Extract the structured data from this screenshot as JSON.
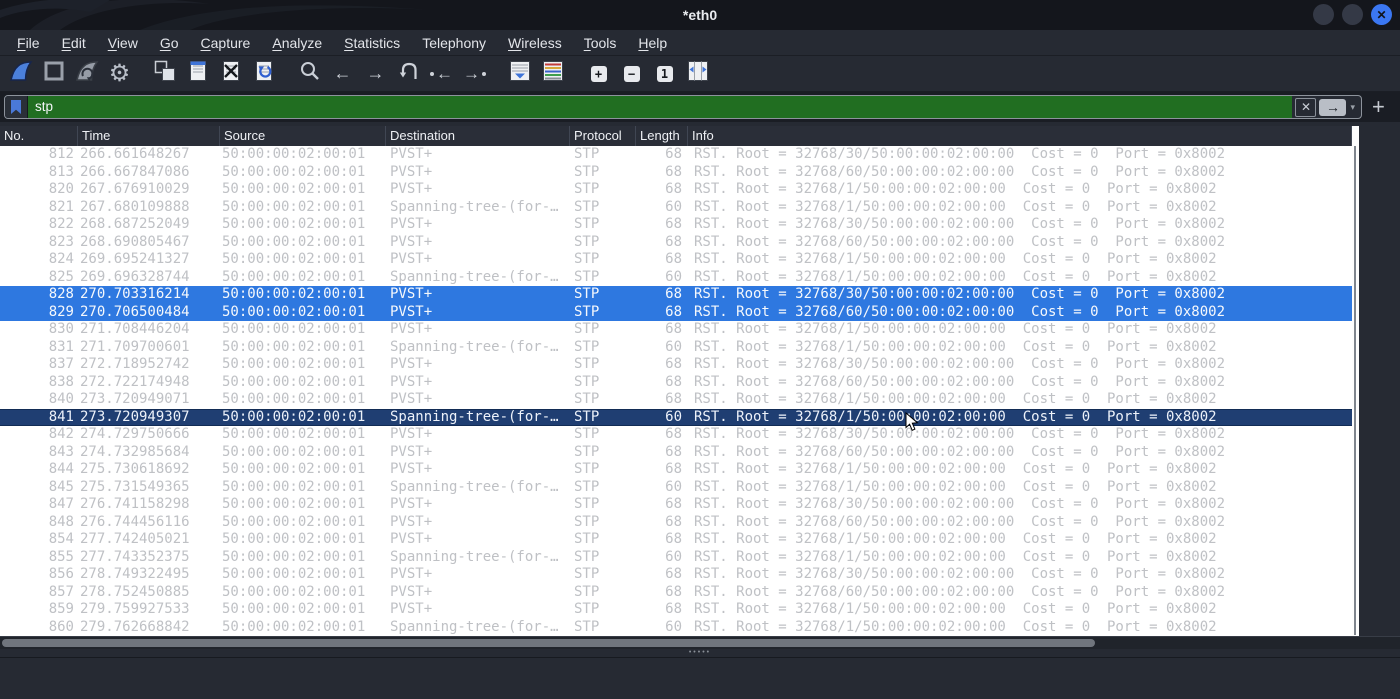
{
  "window": {
    "title": "*eth0"
  },
  "colors": {
    "filter_valid_bg": "#216e21",
    "selected_row": "#2e78e0",
    "focused_row": "#1f3e72",
    "row_fg": "#bfc1c5",
    "close_button": "#3b77f2"
  },
  "menu": {
    "items": [
      {
        "label": "File",
        "mnemonic": "F"
      },
      {
        "label": "Edit",
        "mnemonic": "E"
      },
      {
        "label": "View",
        "mnemonic": "V"
      },
      {
        "label": "Go",
        "mnemonic": "G"
      },
      {
        "label": "Capture",
        "mnemonic": "C"
      },
      {
        "label": "Analyze",
        "mnemonic": "A"
      },
      {
        "label": "Statistics",
        "mnemonic": "S"
      },
      {
        "label": "Telephony",
        "mnemonic": null
      },
      {
        "label": "Wireless",
        "mnemonic": "W"
      },
      {
        "label": "Tools",
        "mnemonic": "T"
      },
      {
        "label": "Help",
        "mnemonic": "H"
      }
    ]
  },
  "toolbar": {
    "buttons": [
      {
        "name": "start-capture",
        "gap": false
      },
      {
        "name": "stop-capture",
        "gap": false
      },
      {
        "name": "restart-capture",
        "gap": false
      },
      {
        "name": "capture-options",
        "gap": false
      },
      {
        "name": "open-file",
        "gap": true
      },
      {
        "name": "save-file",
        "gap": false
      },
      {
        "name": "close-file",
        "gap": false
      },
      {
        "name": "reload-file",
        "gap": false
      },
      {
        "name": "find-packet",
        "gap": true
      },
      {
        "name": "go-back",
        "gap": false
      },
      {
        "name": "go-forward",
        "gap": false
      },
      {
        "name": "go-to-packet",
        "gap": false
      },
      {
        "name": "go-first-packet",
        "gap": false
      },
      {
        "name": "go-last-packet",
        "gap": false
      },
      {
        "name": "auto-scroll",
        "gap": true
      },
      {
        "name": "colorize-packets",
        "gap": false
      },
      {
        "name": "zoom-in",
        "gap": true
      },
      {
        "name": "zoom-out",
        "gap": false
      },
      {
        "name": "zoom-100",
        "gap": false
      },
      {
        "name": "resize-columns",
        "gap": false
      }
    ],
    "zoom_in_label": "+",
    "zoom_out_label": "-",
    "zoom_100_label": "1"
  },
  "filter": {
    "value": "stp",
    "apply_arrow": "→",
    "clear_x": "✕",
    "caret": "▾",
    "add_button": "+"
  },
  "packet_list": {
    "columns": [
      {
        "label": "No."
      },
      {
        "label": "Time"
      },
      {
        "label": "Source"
      },
      {
        "label": "Destination"
      },
      {
        "label": "Protocol"
      },
      {
        "label": "Length"
      },
      {
        "label": "Info"
      }
    ],
    "rows": [
      {
        "no": "812",
        "time": "266.661648267",
        "source": "50:00:00:02:00:01",
        "destination": "PVST+",
        "protocol": "STP",
        "length": "68",
        "info": "RST. Root = 32768/30/50:00:00:02:00:00  Cost = 0  Port = 0x8002",
        "state": "normal"
      },
      {
        "no": "813",
        "time": "266.667847086",
        "source": "50:00:00:02:00:01",
        "destination": "PVST+",
        "protocol": "STP",
        "length": "68",
        "info": "RST. Root = 32768/60/50:00:00:02:00:00  Cost = 0  Port = 0x8002",
        "state": "normal"
      },
      {
        "no": "820",
        "time": "267.676910029",
        "source": "50:00:00:02:00:01",
        "destination": "PVST+",
        "protocol": "STP",
        "length": "68",
        "info": "RST. Root = 32768/1/50:00:00:02:00:00  Cost = 0  Port = 0x8002",
        "state": "normal"
      },
      {
        "no": "821",
        "time": "267.680109888",
        "source": "50:00:00:02:00:01",
        "destination": "Spanning-tree-(for-…",
        "protocol": "STP",
        "length": "60",
        "info": "RST. Root = 32768/1/50:00:00:02:00:00  Cost = 0  Port = 0x8002",
        "state": "normal"
      },
      {
        "no": "822",
        "time": "268.687252049",
        "source": "50:00:00:02:00:01",
        "destination": "PVST+",
        "protocol": "STP",
        "length": "68",
        "info": "RST. Root = 32768/30/50:00:00:02:00:00  Cost = 0  Port = 0x8002",
        "state": "normal"
      },
      {
        "no": "823",
        "time": "268.690805467",
        "source": "50:00:00:02:00:01",
        "destination": "PVST+",
        "protocol": "STP",
        "length": "68",
        "info": "RST. Root = 32768/60/50:00:00:02:00:00  Cost = 0  Port = 0x8002",
        "state": "normal"
      },
      {
        "no": "824",
        "time": "269.695241327",
        "source": "50:00:00:02:00:01",
        "destination": "PVST+",
        "protocol": "STP",
        "length": "68",
        "info": "RST. Root = 32768/1/50:00:00:02:00:00  Cost = 0  Port = 0x8002",
        "state": "normal"
      },
      {
        "no": "825",
        "time": "269.696328744",
        "source": "50:00:00:02:00:01",
        "destination": "Spanning-tree-(for-…",
        "protocol": "STP",
        "length": "60",
        "info": "RST. Root = 32768/1/50:00:00:02:00:00  Cost = 0  Port = 0x8002",
        "state": "normal"
      },
      {
        "no": "828",
        "time": "270.703316214",
        "source": "50:00:00:02:00:01",
        "destination": "PVST+",
        "protocol": "STP",
        "length": "68",
        "info": "RST. Root = 32768/30/50:00:00:02:00:00  Cost = 0  Port = 0x8002",
        "state": "selected"
      },
      {
        "no": "829",
        "time": "270.706500484",
        "source": "50:00:00:02:00:01",
        "destination": "PVST+",
        "protocol": "STP",
        "length": "68",
        "info": "RST. Root = 32768/60/50:00:00:02:00:00  Cost = 0  Port = 0x8002",
        "state": "selected"
      },
      {
        "no": "830",
        "time": "271.708446204",
        "source": "50:00:00:02:00:01",
        "destination": "PVST+",
        "protocol": "STP",
        "length": "68",
        "info": "RST. Root = 32768/1/50:00:00:02:00:00  Cost = 0  Port = 0x8002",
        "state": "normal"
      },
      {
        "no": "831",
        "time": "271.709700601",
        "source": "50:00:00:02:00:01",
        "destination": "Spanning-tree-(for-…",
        "protocol": "STP",
        "length": "60",
        "info": "RST. Root = 32768/1/50:00:00:02:00:00  Cost = 0  Port = 0x8002",
        "state": "normal"
      },
      {
        "no": "837",
        "time": "272.718952742",
        "source": "50:00:00:02:00:01",
        "destination": "PVST+",
        "protocol": "STP",
        "length": "68",
        "info": "RST. Root = 32768/30/50:00:00:02:00:00  Cost = 0  Port = 0x8002",
        "state": "normal"
      },
      {
        "no": "838",
        "time": "272.722174948",
        "source": "50:00:00:02:00:01",
        "destination": "PVST+",
        "protocol": "STP",
        "length": "68",
        "info": "RST. Root = 32768/60/50:00:00:02:00:00  Cost = 0  Port = 0x8002",
        "state": "normal"
      },
      {
        "no": "840",
        "time": "273.720949071",
        "source": "50:00:00:02:00:01",
        "destination": "PVST+",
        "protocol": "STP",
        "length": "68",
        "info": "RST. Root = 32768/1/50:00:00:02:00:00  Cost = 0  Port = 0x8002",
        "state": "normal"
      },
      {
        "no": "841",
        "time": "273.720949307",
        "source": "50:00:00:02:00:01",
        "destination": "Spanning-tree-(for-…",
        "protocol": "STP",
        "length": "60",
        "info": "RST. Root = 32768/1/50:00:00:02:00:00  Cost = 0  Port = 0x8002",
        "state": "focused"
      },
      {
        "no": "842",
        "time": "274.729750666",
        "source": "50:00:00:02:00:01",
        "destination": "PVST+",
        "protocol": "STP",
        "length": "68",
        "info": "RST. Root = 32768/30/50:00:00:02:00:00  Cost = 0  Port = 0x8002",
        "state": "normal"
      },
      {
        "no": "843",
        "time": "274.732985684",
        "source": "50:00:00:02:00:01",
        "destination": "PVST+",
        "protocol": "STP",
        "length": "68",
        "info": "RST. Root = 32768/60/50:00:00:02:00:00  Cost = 0  Port = 0x8002",
        "state": "normal"
      },
      {
        "no": "844",
        "time": "275.730618692",
        "source": "50:00:00:02:00:01",
        "destination": "PVST+",
        "protocol": "STP",
        "length": "68",
        "info": "RST. Root = 32768/1/50:00:00:02:00:00  Cost = 0  Port = 0x8002",
        "state": "normal"
      },
      {
        "no": "845",
        "time": "275.731549365",
        "source": "50:00:00:02:00:01",
        "destination": "Spanning-tree-(for-…",
        "protocol": "STP",
        "length": "60",
        "info": "RST. Root = 32768/1/50:00:00:02:00:00  Cost = 0  Port = 0x8002",
        "state": "normal"
      },
      {
        "no": "847",
        "time": "276.741158298",
        "source": "50:00:00:02:00:01",
        "destination": "PVST+",
        "protocol": "STP",
        "length": "68",
        "info": "RST. Root = 32768/30/50:00:00:02:00:00  Cost = 0  Port = 0x8002",
        "state": "normal"
      },
      {
        "no": "848",
        "time": "276.744456116",
        "source": "50:00:00:02:00:01",
        "destination": "PVST+",
        "protocol": "STP",
        "length": "68",
        "info": "RST. Root = 32768/60/50:00:00:02:00:00  Cost = 0  Port = 0x8002",
        "state": "normal"
      },
      {
        "no": "854",
        "time": "277.742405021",
        "source": "50:00:00:02:00:01",
        "destination": "PVST+",
        "protocol": "STP",
        "length": "68",
        "info": "RST. Root = 32768/1/50:00:00:02:00:00  Cost = 0  Port = 0x8002",
        "state": "normal"
      },
      {
        "no": "855",
        "time": "277.743352375",
        "source": "50:00:00:02:00:01",
        "destination": "Spanning-tree-(for-…",
        "protocol": "STP",
        "length": "60",
        "info": "RST. Root = 32768/1/50:00:00:02:00:00  Cost = 0  Port = 0x8002",
        "state": "normal"
      },
      {
        "no": "856",
        "time": "278.749322495",
        "source": "50:00:00:02:00:01",
        "destination": "PVST+",
        "protocol": "STP",
        "length": "68",
        "info": "RST. Root = 32768/30/50:00:00:02:00:00  Cost = 0  Port = 0x8002",
        "state": "normal"
      },
      {
        "no": "857",
        "time": "278.752450885",
        "source": "50:00:00:02:00:01",
        "destination": "PVST+",
        "protocol": "STP",
        "length": "68",
        "info": "RST. Root = 32768/60/50:00:00:02:00:00  Cost = 0  Port = 0x8002",
        "state": "normal"
      },
      {
        "no": "859",
        "time": "279.759927533",
        "source": "50:00:00:02:00:01",
        "destination": "PVST+",
        "protocol": "STP",
        "length": "68",
        "info": "RST. Root = 32768/1/50:00:00:02:00:00  Cost = 0  Port = 0x8002",
        "state": "normal"
      },
      {
        "no": "860",
        "time": "279.762668842",
        "source": "50:00:00:02:00:01",
        "destination": "Spanning-tree-(for-…",
        "protocol": "STP",
        "length": "60",
        "info": "RST. Root = 32768/1/50:00:00:02:00:00  Cost = 0  Port = 0x8002",
        "state": "normal"
      }
    ]
  }
}
